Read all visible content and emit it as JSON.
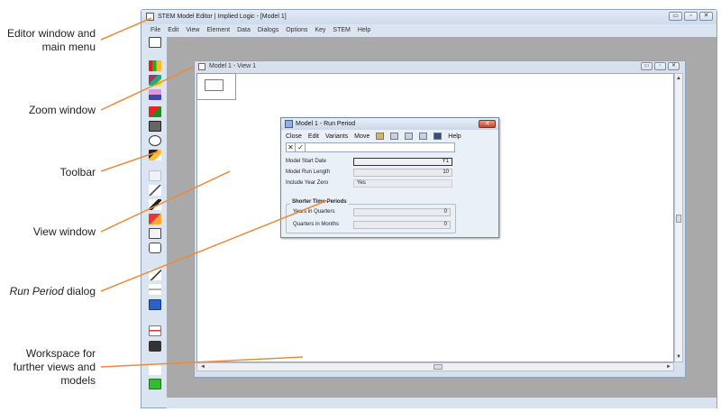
{
  "annotations": {
    "editor": "Editor window and main menu",
    "zoom": "Zoom window",
    "toolbar": "Toolbar",
    "view": "View window",
    "run_period_italic": "Run Period",
    "run_period_rest": " dialog",
    "workspace": "Workspace for further views and models"
  },
  "app": {
    "title": "STEM Model Editor | Implied Logic - [Model 1]",
    "window_buttons": [
      "▭",
      "▫",
      "✕"
    ],
    "menu": [
      "File",
      "Edit",
      "View",
      "Element",
      "Data",
      "Dialogs",
      "Options",
      "Key",
      "STEM",
      "Help"
    ]
  },
  "view_window": {
    "title": "Model 1 - View 1",
    "window_buttons": [
      "▭",
      "▫",
      "✕"
    ],
    "scroll_up": "▲",
    "scroll_down": "▼",
    "scroll_left": "◄",
    "scroll_right": "►"
  },
  "dialog": {
    "title": "Model 1 - Run Period",
    "close_symbol": "✕",
    "menu": {
      "close": "Close",
      "edit": "Edit",
      "variants": "Variants",
      "move": "Move",
      "help": "Help"
    },
    "cancel_symbol": "✕",
    "accept_symbol": "✓",
    "fields": [
      {
        "label": "Model Start Date",
        "value": "Y1"
      },
      {
        "label": "Model Run Length",
        "value": "10"
      },
      {
        "label": "Include Year Zero",
        "value": "Yes"
      }
    ],
    "group_title": "Shorter Time Periods",
    "group_fields": [
      {
        "label": "Years in Quarters",
        "value": "0"
      },
      {
        "label": "Quarters in Months",
        "value": "0"
      }
    ]
  },
  "colors": {
    "callout_line": "#ee8a3a",
    "workspace": "#a9a9a9",
    "frame": "#dbe5f1"
  },
  "icons": [
    "app-icon",
    "view-icon",
    "dialog-icon",
    "toolbar-icons"
  ]
}
